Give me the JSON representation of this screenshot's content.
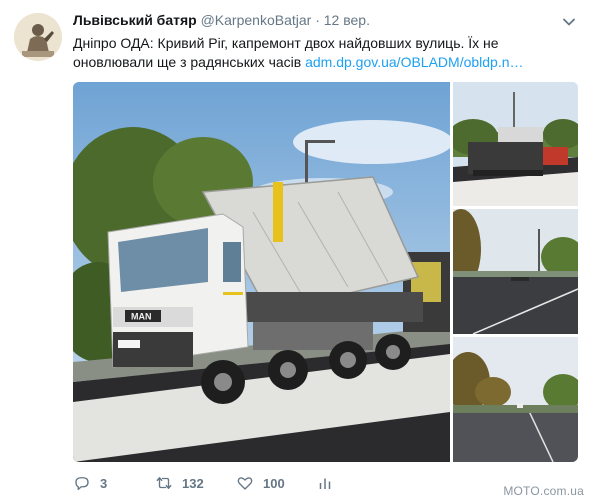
{
  "tweet": {
    "author_name": "Львівський батяр",
    "author_handle": "@KarpenkoBatjar",
    "separator": "·",
    "date": "12 вер.",
    "text": "Дніпро ОДА: Кривий Ріг, капремонт двох найдовших вулиць. Їх не оновлювали ще з радянських часів ",
    "link_text": "adm.dp.gov.ua/OBLADM/obldp.n…",
    "truck_plate": "MAN"
  },
  "actions": {
    "replies": "3",
    "retweets": "132",
    "likes": "100"
  },
  "icons": {
    "caret": "chevron-down-icon",
    "reply": "reply-icon",
    "retweet": "retweet-icon",
    "like": "heart-icon",
    "stats": "analytics-icon"
  },
  "colors": {
    "link": "#1da1f2",
    "meta": "#657786",
    "text": "#14171a"
  },
  "watermark": "MOTO.com.ua"
}
